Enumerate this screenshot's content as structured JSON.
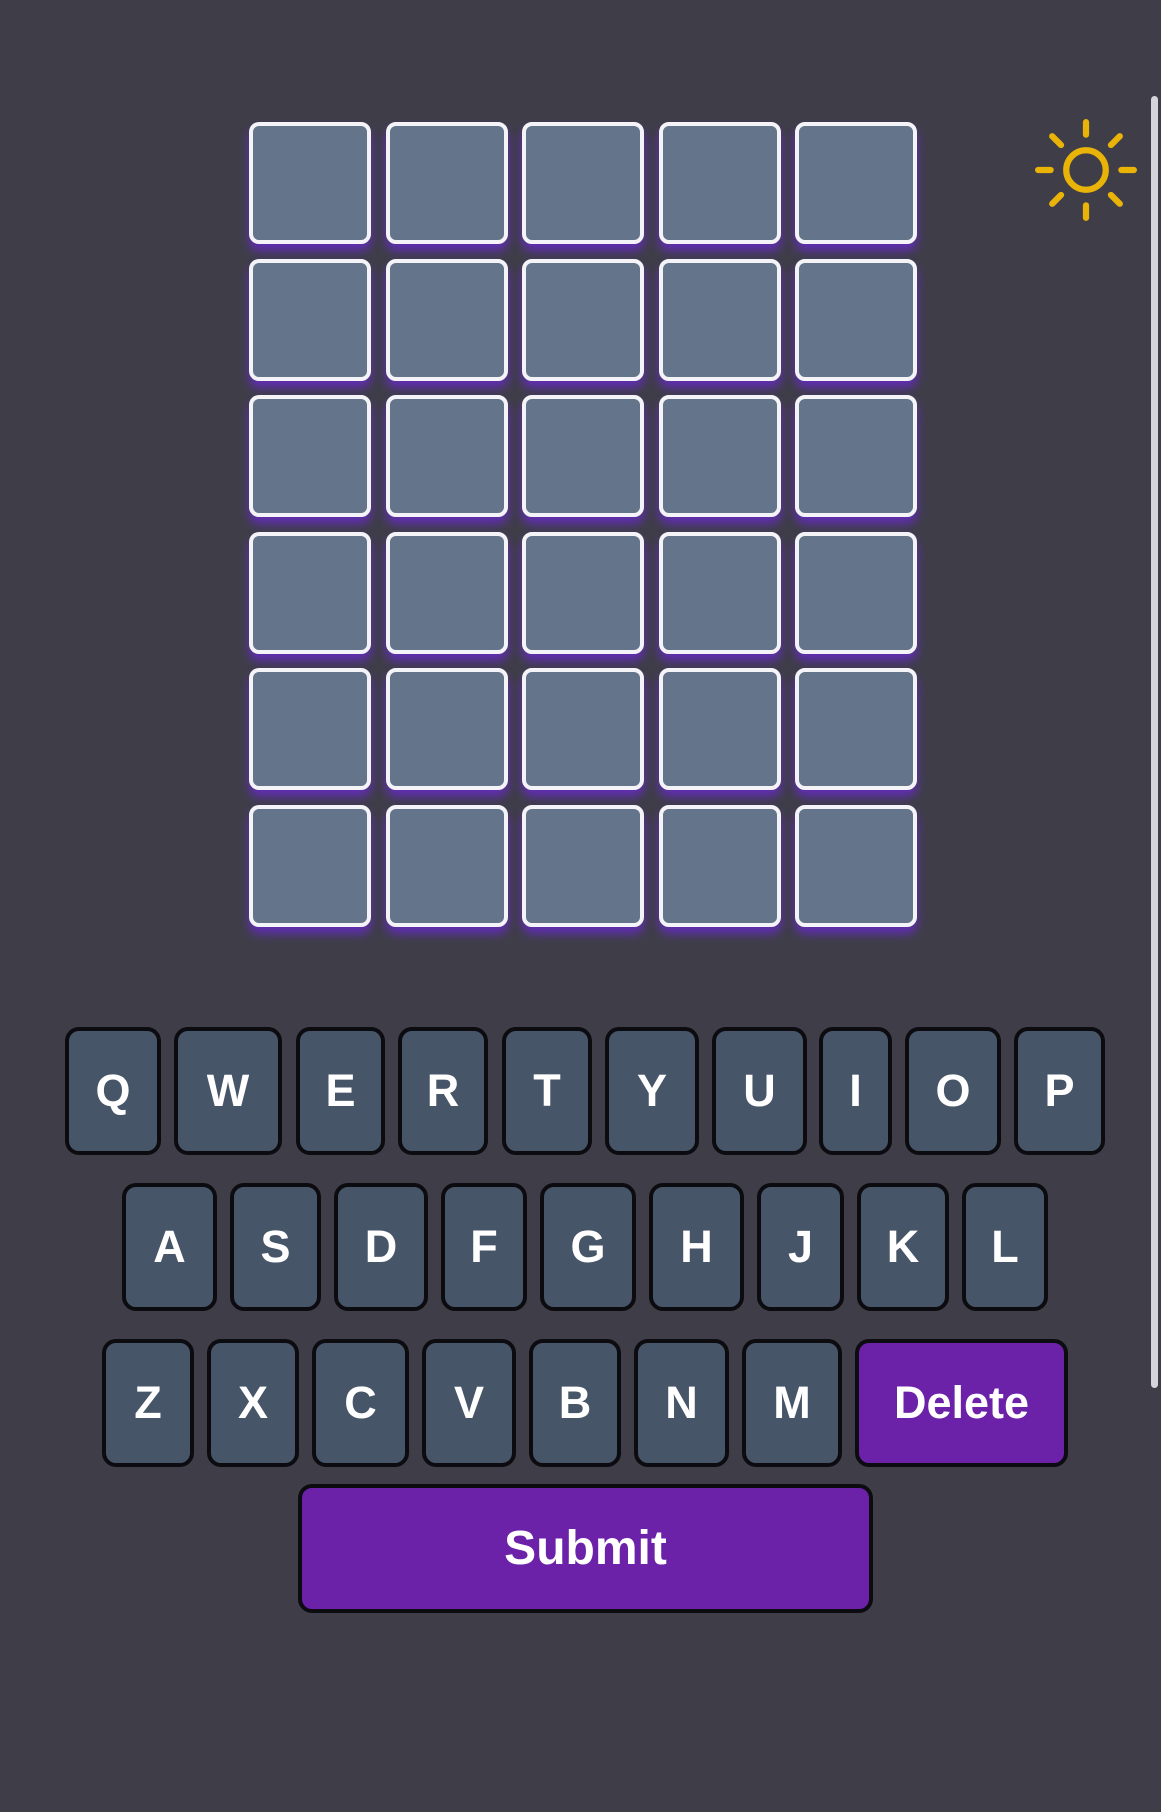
{
  "theme_toggle": {
    "icon": "sun-icon",
    "color": "#eab308"
  },
  "board": {
    "rows": [
      [
        "",
        "",
        "",
        "",
        ""
      ],
      [
        "",
        "",
        "",
        "",
        ""
      ],
      [
        "",
        "",
        "",
        "",
        ""
      ],
      [
        "",
        "",
        "",
        "",
        ""
      ],
      [
        "",
        "",
        "",
        "",
        ""
      ],
      [
        "",
        "",
        "",
        "",
        ""
      ]
    ]
  },
  "keyboard": {
    "row1": [
      "Q",
      "W",
      "E",
      "R",
      "T",
      "Y",
      "U",
      "I",
      "O",
      "P"
    ],
    "row2": [
      "A",
      "S",
      "D",
      "F",
      "G",
      "H",
      "J",
      "K",
      "L"
    ],
    "row3": [
      "Z",
      "X",
      "C",
      "V",
      "B",
      "N",
      "M"
    ],
    "delete_label": "Delete",
    "submit_label": "Submit"
  },
  "colors": {
    "background": "#3f3e48",
    "tile": "#64748b",
    "key": "#475569",
    "accent": "#6b21a8"
  }
}
